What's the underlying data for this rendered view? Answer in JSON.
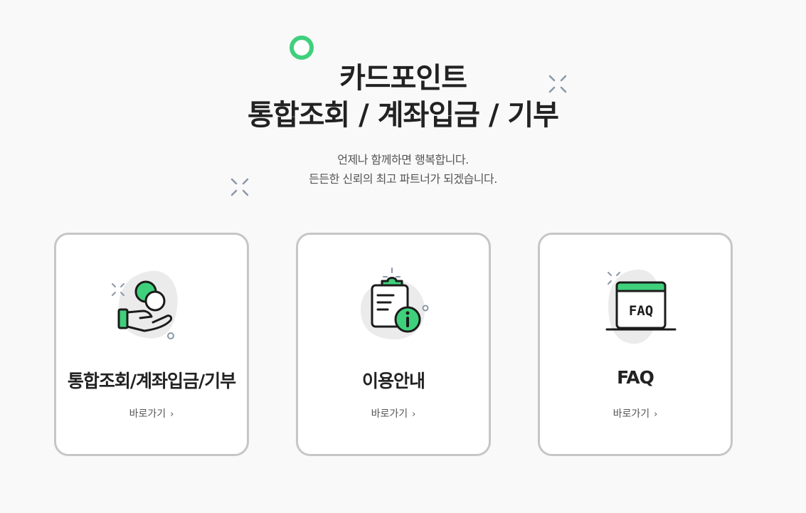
{
  "hero": {
    "title_line1": "카드포인트",
    "title_line2": "통합조회 / 계좌입금 / 기부",
    "subtitle_line1": "언제나 함께하면 행복합니다.",
    "subtitle_line2": "든든한 신뢰의 최고 파트너가 되겠습니다."
  },
  "cards": [
    {
      "title": "통합조회/계좌입금/기부",
      "link": "바로가기",
      "icon": "coin-hand-icon"
    },
    {
      "title": "이용안내",
      "link": "바로가기",
      "icon": "clipboard-info-icon"
    },
    {
      "title": "FAQ",
      "link": "바로가기",
      "icon": "faq-window-icon",
      "icon_text": "FAQ"
    }
  ],
  "chevron": "›",
  "colors": {
    "accent": "#3fd07c",
    "card_border": "#c6c6c6",
    "blob": "#ebebeb",
    "sparkle": "#8b97a8"
  }
}
